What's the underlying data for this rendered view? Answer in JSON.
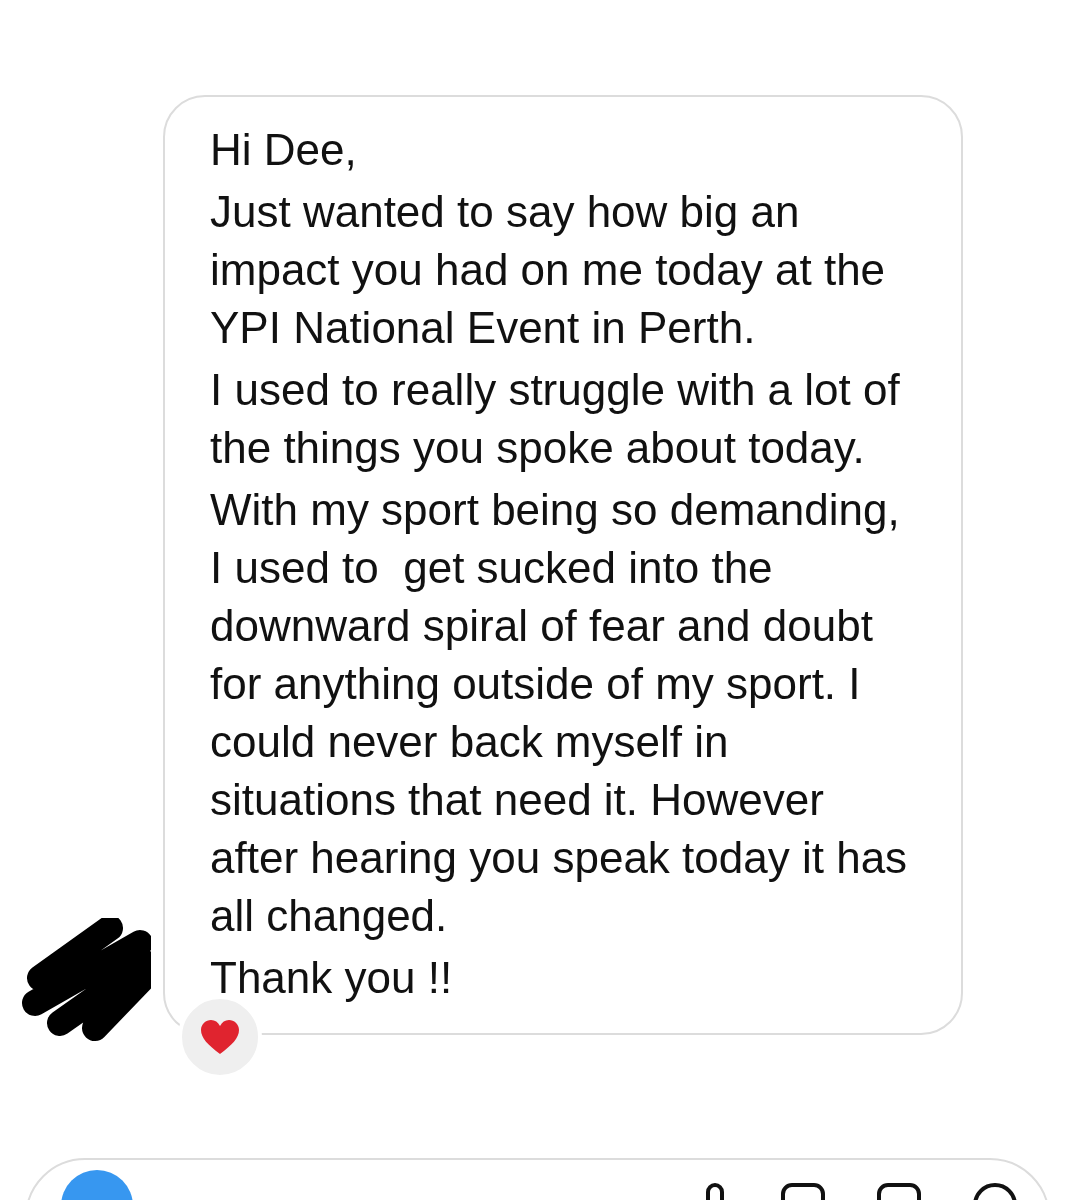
{
  "message": {
    "paragraphs": [
      "Hi Dee,",
      "Just wanted to say how big an impact you had on me today at the YPI National Event in Perth.",
      "I used to really struggle with a lot of the things you spoke about today.",
      "With my sport being so demanding, I used to  get sucked into the downward spiral of fear and doubt for anything outside of my sport. I could never back myself in situations that need it. However after hearing you speak today it has all changed.",
      "Thank you !!"
    ]
  }
}
